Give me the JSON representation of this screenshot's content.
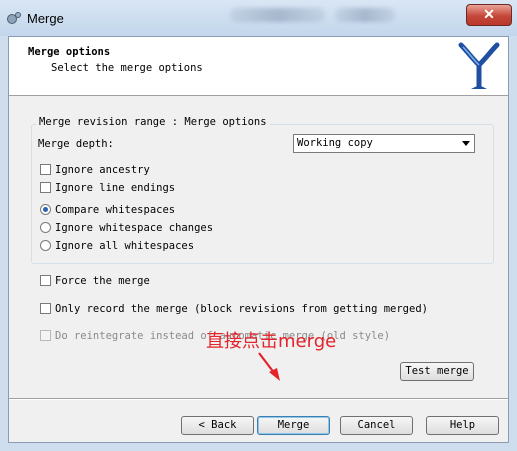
{
  "window": {
    "title": "Merge",
    "close_label": "✕"
  },
  "header": {
    "title": "Merge options",
    "subtitle": "Select the merge options"
  },
  "group": {
    "legend": "Merge revision range : Merge options",
    "depth_label": "Merge depth:",
    "depth_value": "Working copy",
    "ignore_ancestry": {
      "label": "Ignore ancestry",
      "checked": false
    },
    "ignore_line_endings": {
      "label": "Ignore line endings",
      "checked": false
    },
    "whitespace_options": [
      {
        "label": "Compare whitespaces",
        "selected": true
      },
      {
        "label": "Ignore whitespace changes",
        "selected": false
      },
      {
        "label": "Ignore all whitespaces",
        "selected": false
      }
    ]
  },
  "options": {
    "force": {
      "label": "Force the merge",
      "checked": false
    },
    "only_record": {
      "label": "Only record the merge (block revisions from getting merged)",
      "checked": false
    },
    "reintegrate": {
      "label": "Do reintegrate instead of automatic merge (old style)",
      "checked": false,
      "enabled": false
    }
  },
  "buttons": {
    "test_merge": "Test merge",
    "back": "< Back",
    "merge": "Merge",
    "cancel": "Cancel",
    "help": "Help"
  },
  "annotation": {
    "text": "直接点击merge",
    "color": "#e4232a"
  }
}
